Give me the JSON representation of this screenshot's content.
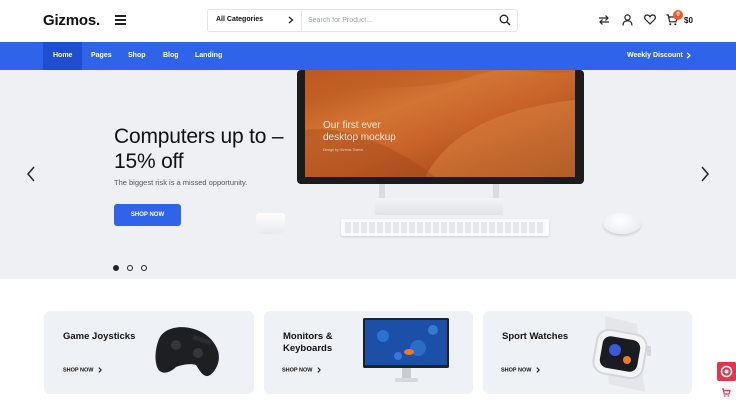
{
  "header": {
    "logo": "Gizmos.",
    "category": "All Categories",
    "search_placeholder": "Search for Product...",
    "cart_count": "0",
    "cart_total": "$0"
  },
  "nav": {
    "items": [
      "Home",
      "Pages",
      "Shop",
      "Blog",
      "Landing"
    ],
    "weekly": "Weekly Discount"
  },
  "hero": {
    "title": "Computers up to – 15% off",
    "subtitle": "The biggest risk is a missed opportunity.",
    "button": "SHOP NOW",
    "screen_text": "Our first ever desktop mockup",
    "screen_small": "Design by Gizmos Theme"
  },
  "cards": [
    {
      "title": "Game Joysticks",
      "link": "SHOP NOW"
    },
    {
      "title": "Monitors & Keyboards",
      "link": "SHOP NOW"
    },
    {
      "title": "Sport Watches",
      "link": "SHOP NOW"
    }
  ],
  "icons": {
    "menu": "menu-icon",
    "search": "search-icon",
    "compare": "compare-icon",
    "account": "user-icon",
    "wishlist": "heart-icon",
    "cart": "cart-icon"
  },
  "colors": {
    "accent": "#2f64ea",
    "badge": "#f05a28",
    "hero_bg": "#eef0f4"
  }
}
